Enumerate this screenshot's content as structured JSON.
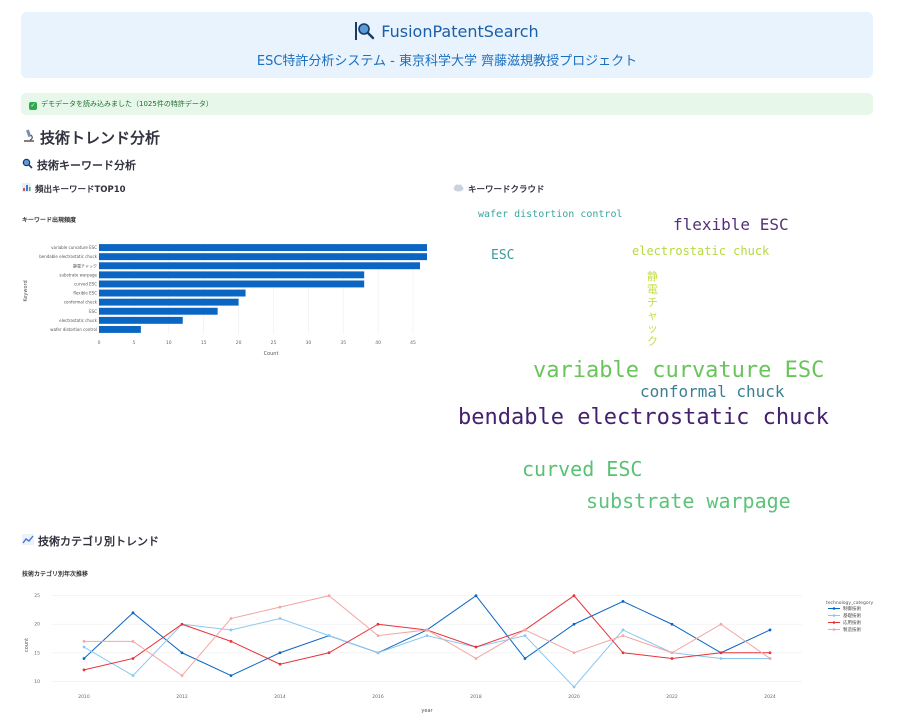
{
  "header": {
    "title": "FusionPatentSearch",
    "subtitle": "ESC特許分析システム - 東京科学大学 齊藤滋規教授プロジェクト"
  },
  "notice": {
    "text": "デモデータを読み込みました（1025件の特許データ）"
  },
  "sections": {
    "trend_title": "技術トレンド分析",
    "keyword_title": "技術キーワード分析",
    "top10_title": "頻出キーワードTOP10",
    "cloud_title": "キーワードクラウド",
    "category_title": "技術カテゴリ別トレンド"
  },
  "icons": {
    "header": "magnifier-icon",
    "notice": "check-icon",
    "trend": "microscope-icon",
    "keyword": "magnifier-icon",
    "top10": "bar-chart-icon",
    "cloud": "cloud-icon",
    "category": "line-chart-icon"
  },
  "wordcloud": [
    {
      "word": "wafer distortion control",
      "color": "#3aa5a0"
    },
    {
      "word": "flexible ESC",
      "color": "#55307a"
    },
    {
      "word": "ESC",
      "color": "#3b9a9b"
    },
    {
      "word": "electrostatic chuck",
      "color": "#b7d93f"
    },
    {
      "word": "静電チャック",
      "color": "#c4e04a"
    },
    {
      "word": "variable curvature ESC",
      "color": "#69c45a"
    },
    {
      "word": "conformal chuck",
      "color": "#3b7f93"
    },
    {
      "word": "bendable electrostatic chuck",
      "color": "#44206f"
    },
    {
      "word": "curved ESC",
      "color": "#59c272"
    },
    {
      "word": "substrate warpage",
      "color": "#5cc47a"
    }
  ],
  "chart_data": [
    {
      "type": "bar",
      "orientation": "horizontal",
      "title": "キーワード出現頻度",
      "xlabel": "Count",
      "ylabel": "Keyword",
      "categories": [
        "variable curvature ESC",
        "bendable electrostatic chuck",
        "静電チャック",
        "substrate warpage",
        "curved ESC",
        "flexible ESC",
        "conformal chuck",
        "ESC",
        "electrostatic chuck",
        "wafer distortion control"
      ],
      "values": [
        47,
        47,
        46,
        38,
        38,
        21,
        20,
        17,
        12,
        6
      ],
      "xlim": [
        0,
        47
      ],
      "xticks": [
        0,
        5,
        10,
        15,
        20,
        25,
        30,
        35,
        40,
        45
      ],
      "color": "#0b66c3"
    },
    {
      "type": "line",
      "title": "技術カテゴリ別年次推移",
      "xlabel": "year",
      "ylabel": "count",
      "legend_title": "technology_category",
      "legend_position": "right",
      "x": [
        2010,
        2011,
        2012,
        2013,
        2014,
        2015,
        2016,
        2017,
        2018,
        2019,
        2020,
        2021,
        2022,
        2023,
        2024
      ],
      "xticks": [
        2010,
        2012,
        2014,
        2016,
        2018,
        2020,
        2022,
        2024
      ],
      "ylim": [
        9,
        26
      ],
      "yticks": [
        10,
        15,
        20,
        25
      ],
      "series": [
        {
          "name": "制御技術",
          "color": "#0b66c3",
          "values": [
            14,
            22,
            15,
            11,
            15,
            18,
            15,
            19,
            25,
            14,
            20,
            24,
            20,
            15,
            19
          ]
        },
        {
          "name": "基礎技術",
          "color": "#8cc7f0",
          "values": [
            16,
            11,
            20,
            19,
            21,
            18,
            15,
            18,
            16,
            18,
            9,
            19,
            15,
            14,
            14
          ]
        },
        {
          "name": "応用技術",
          "color": "#e8323a",
          "values": [
            12,
            14,
            20,
            17,
            13,
            15,
            20,
            19,
            16,
            19,
            25,
            15,
            14,
            15,
            15
          ]
        },
        {
          "name": "製造技術",
          "color": "#f3a6a6",
          "values": [
            17,
            17,
            11,
            21,
            23,
            25,
            18,
            19,
            14,
            19,
            15,
            18,
            15,
            20,
            14
          ]
        }
      ]
    }
  ]
}
